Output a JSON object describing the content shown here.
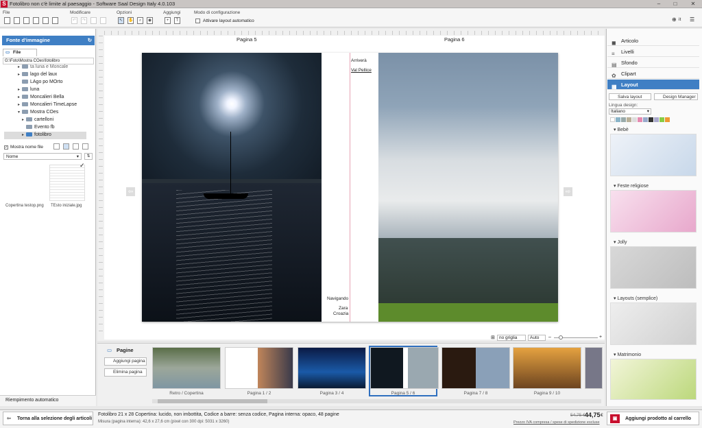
{
  "window": {
    "title": "Fotolibro non c'è limite al paesaggio - Software Saal Design Italy 4.0.103"
  },
  "toolbar": {
    "file_label": "File",
    "modify_label": "Modificare",
    "options_label": "Opzioni",
    "add_label": "Aggiungi",
    "config_label": "Modo di configurazione",
    "auto_layout_label": "Attivare layout automatico",
    "lang_label": "it"
  },
  "left": {
    "header": "Fonte d'immagine",
    "tab": "File system",
    "path": "G:\\Foto\\Mostra COes\\fotolibro",
    "tree": [
      "ta luna e Moncale",
      "lago del laux",
      "LAgo po MOrto",
      "luna",
      "Moncalieri Bella",
      "Moncalieri TimeLapse",
      "Mostra COes",
      "cartelloni",
      "Evento fb",
      "fotolibro"
    ],
    "show_filename": "Mostra nome file",
    "sort": "Nome",
    "files": [
      "Copertina testop.png",
      "TEsto iniziale.jpg"
    ],
    "auto_fill": "Riempimento automatico"
  },
  "canvas": {
    "page_left": "Pagina 5",
    "page_right": "Pagina 6",
    "text_top1": "Arriverà",
    "text_top2": "Val Pellice",
    "text_bottom1": "Navigando",
    "text_bottom2": "Zara",
    "text_bottom3": "Croazia",
    "grid_option": "no griglia",
    "zoom_option": "Auto"
  },
  "pages": {
    "title": "Pagine",
    "add": "Aggiungi pagina",
    "delete": "Elimina pagina",
    "thumbs": [
      "Retro / Copertina",
      "Pagina 1 / 2",
      "Pagina 3 / 4",
      "Pagina 5 / 6",
      "Pagina 7 / 8",
      "Pagina 9 / 10"
    ]
  },
  "right": {
    "items": [
      "Articolo",
      "Livelli",
      "Sfondo",
      "Clipart",
      "Layout"
    ],
    "save_layout": "Salva layout",
    "design_manager": "Design Manager",
    "language_label": "Lingua design:",
    "language": "Italiano",
    "templates": [
      "Bebè",
      "Feste religiose",
      "Jolly",
      "Layouts (semplice)",
      "Matrimonio"
    ]
  },
  "status": {
    "back": "Torna alla selezione degli articoli",
    "product": "Fotolibro 21 x 28 Copertina: lucido, non imbottita, Codice a barre: senza codice, Pagina interna: opaco, 48 pagine",
    "measure": "Misura (pagina interna): 42,6 x 27,6 cm (pixel con 300 dpi: 5031 x 3260)",
    "old_price": "54,75 €",
    "price": "44,75",
    "currency": "€",
    "vat": "Prezzo IVA compresa / spese di spedizione escluse",
    "cart": "Aggiungi prodotto al carrello"
  },
  "colors": {
    "accent": "#3f7fc4",
    "cart": "#c8102e"
  }
}
